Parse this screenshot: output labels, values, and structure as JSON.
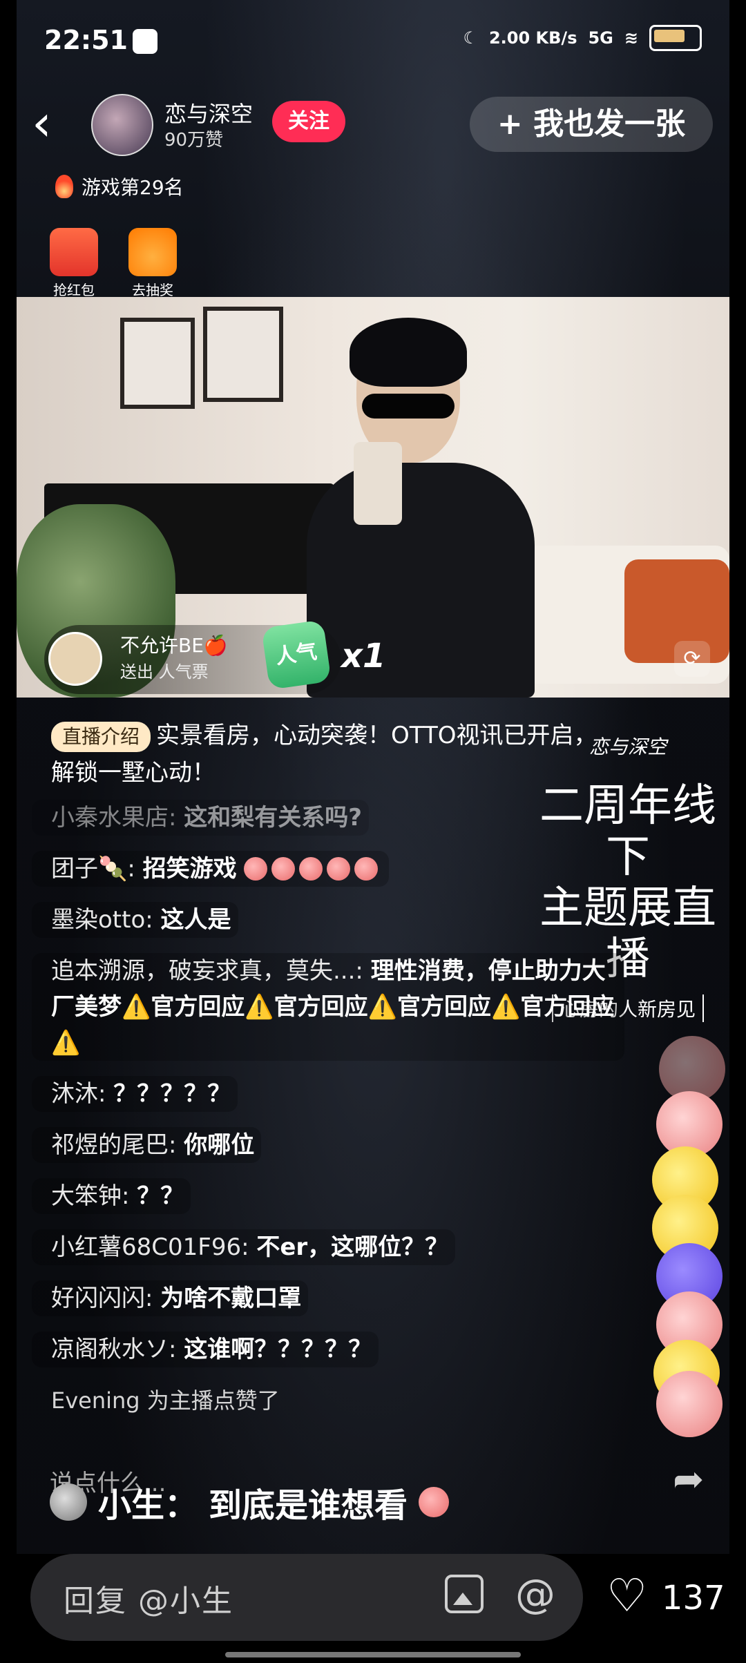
{
  "status_bar": {
    "time": "22:51",
    "network_speed": "2.00 KB/s",
    "signal": "5G"
  },
  "header": {
    "back_icon": "back-chevron-icon",
    "username": "恋与深空",
    "likes": "90万赞",
    "follow_label": "关注",
    "me_too_label": "+ 我也发一张"
  },
  "rank": {
    "text": "游戏第29名"
  },
  "gifts": [
    {
      "label": "抢红包",
      "icon": "red-packet-icon"
    },
    {
      "label": "去抽奖",
      "icon": "lucky-bag-icon"
    }
  ],
  "video": {
    "gift_user": "不允许BE🍎",
    "gift_action": "送出 人气票",
    "gift_ticket": "人气",
    "gift_count": "x1"
  },
  "intro": {
    "tag": "直播介绍",
    "text": "实景看房，心动突袭！OTTO视讯已开启，解锁一墅心动！"
  },
  "logo": {
    "small": "恋与深空",
    "big_line1": "二周年线下",
    "big_line2": "主题展直播",
    "tagline": "心房的人新房见"
  },
  "chat": [
    {
      "nick": "小秦水果店:",
      "text": "这和梨有关系吗?",
      "faded": true
    },
    {
      "nick": "团子🍡:",
      "text": "招笑游戏",
      "emoji_count": 5
    },
    {
      "nick": "墨染otto:",
      "text": "这人是"
    },
    {
      "nick": "追本溯源，破妄求真，莫失...:",
      "text": "理性消费，停止助力大厂美梦⚠️官方回应⚠️官方回应⚠️官方回应⚠️官方回应⚠️"
    },
    {
      "nick": "沐沐:",
      "text": "？？？？？"
    },
    {
      "nick": "祁煜的尾巴:",
      "text": "你哪位"
    },
    {
      "nick": "大笨钟:",
      "text": "？？"
    },
    {
      "nick": "小红薯68C01F96:",
      "text": "不er，这哪位？？"
    },
    {
      "nick": "好闪闪闪:",
      "text": "为啥不戴口罩"
    },
    {
      "nick": "凉阁秋水ソ:",
      "text": "这谁啊？？？？？"
    }
  ],
  "notice": "Evening 为主播点赞了",
  "say_hint": "说点什么...",
  "reply_bubble": {
    "name": "小生：",
    "text": "到底是谁想看"
  },
  "bottom": {
    "reply_placeholder": "回复 @小生",
    "like_count": "137"
  }
}
